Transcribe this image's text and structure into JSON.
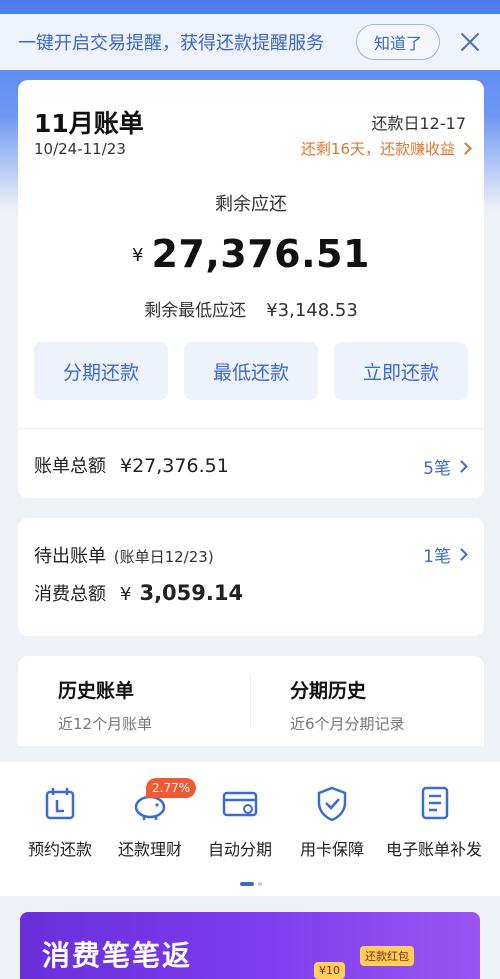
{
  "notice": {
    "text": "一键开启交易提醒，获得还款提醒服务",
    "button": "知道了"
  },
  "bill": {
    "title": "11月账单",
    "range": "10/24-11/23",
    "due_date": "还款日12-17",
    "due_remain": "还剩16天，还款赚收益",
    "remaining_label": "剩余应还",
    "currency": "¥",
    "remaining_amount": "27,376.51",
    "min_due_label": "剩余最低应还",
    "min_due_value": "¥3,148.53",
    "buttons": [
      "分期还款",
      "最低还款",
      "立即还款"
    ],
    "total_label": "账单总额",
    "total_value": "¥27,376.51",
    "total_count": "5笔"
  },
  "pending": {
    "title": "待出账单",
    "sub": "(账单日12/23)",
    "count": "1笔",
    "spend_label": "消费总额",
    "currency": "¥",
    "spend_value": "3,059.14"
  },
  "history": [
    {
      "title": "历史账单",
      "sub": "近12个月账单"
    },
    {
      "title": "分期历史",
      "sub": "近6个月分期记录"
    }
  ],
  "services": {
    "badge": "2.77%",
    "items": [
      {
        "label": "预约还款",
        "icon": "calendar-icon"
      },
      {
        "label": "还款理财",
        "icon": "piggy-bank-icon"
      },
      {
        "label": "自动分期",
        "icon": "card-cycle-icon"
      },
      {
        "label": "用卡保障",
        "icon": "shield-check-icon"
      },
      {
        "label": "电子账单补发",
        "icon": "document-icon"
      }
    ]
  },
  "promo": {
    "text": "消费笔笔返",
    "ticket_1": "¥10",
    "ticket_2": "还款红包"
  },
  "colors": {
    "accent": "#3d6ad0",
    "orange": "#e0772d",
    "badge": "#ef5a35",
    "promo": "#7c3cf0"
  }
}
